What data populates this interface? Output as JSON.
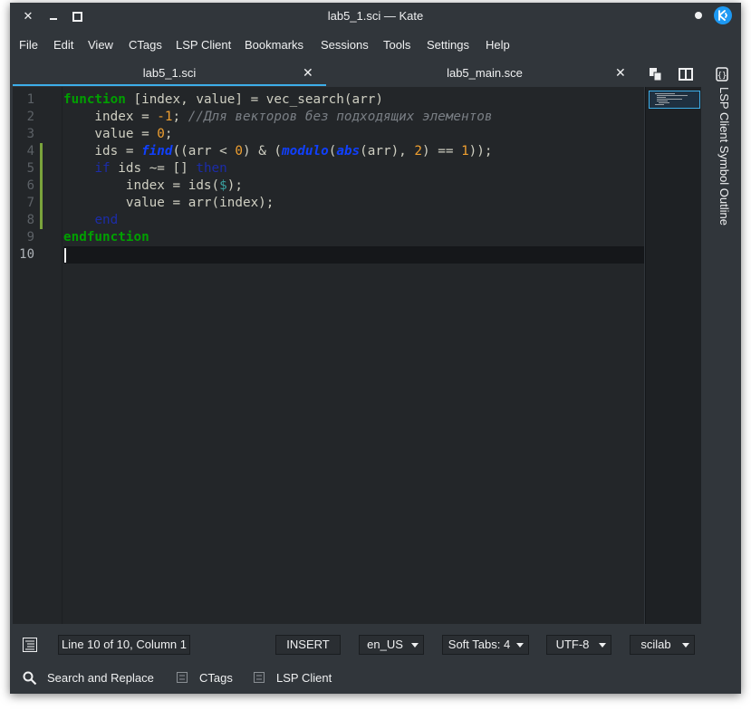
{
  "window": {
    "title": "lab5_1.sci — Kate",
    "controls": {
      "close": "✕"
    }
  },
  "menu": [
    "File",
    "Edit",
    "View",
    "CTags",
    "LSP Client",
    "Bookmarks",
    "Sessions",
    "Tools",
    "Settings",
    "Help"
  ],
  "tabs": [
    {
      "label": "lab5_1.sci",
      "active": true,
      "close": "✕"
    },
    {
      "label": "lab5_main.sce",
      "active": false,
      "close": "✕"
    }
  ],
  "editor": {
    "line_numbers": [
      "1",
      "2",
      "3",
      "4",
      "5",
      "6",
      "7",
      "8",
      "9",
      "10"
    ],
    "current_line": 10,
    "code": {
      "l1": {
        "kw": "function",
        "rest": " [index, value] = vec_search(arr)"
      },
      "l2": {
        "a": "    index = ",
        "num": "-1",
        "b": "; ",
        "comment": "//Для векторов без подходящих элементов"
      },
      "l3": {
        "a": "    value = ",
        "num": "0",
        "b": ";"
      },
      "l4": {
        "a": "    ids = ",
        "fn1": "find",
        "b": "((arr < ",
        "n1": "0",
        "c": ") & (",
        "fn2": "modulo",
        "d": "(",
        "fn3": "abs",
        "e": "(arr), ",
        "n2": "2",
        "f": ") == ",
        "n3": "1",
        "g": "));"
      },
      "l5": {
        "pre": "    ",
        "kw1": "if",
        "mid": " ids ~= [] ",
        "kw2": "then"
      },
      "l6": {
        "a": "        index = ids(",
        "sym": "$",
        "b": ");"
      },
      "l7": {
        "a": "        value = arr(index);"
      },
      "l8": {
        "pre": "    ",
        "kw": "end"
      },
      "l9": {
        "kw": "endfunction"
      }
    }
  },
  "sidebar": {
    "label": "LSP Client Symbol Outline"
  },
  "statusbar": {
    "position": "Line 10 of 10, Column 1",
    "mode": "INSERT",
    "dictionary": "en_US",
    "indent": "Soft Tabs: 4",
    "encoding": "UTF-8",
    "syntax": "scilab"
  },
  "bottom_tools": [
    {
      "label": "Search and Replace",
      "icon": "search-icon"
    },
    {
      "label": "CTags",
      "icon": "ctags-icon"
    },
    {
      "label": "LSP Client",
      "icon": "lsp-icon"
    }
  ],
  "colors": {
    "accent": "#3daee9",
    "background": "#31363b",
    "editor_bg": "#232629",
    "keyword": "#00a000",
    "number": "#f0a030"
  }
}
